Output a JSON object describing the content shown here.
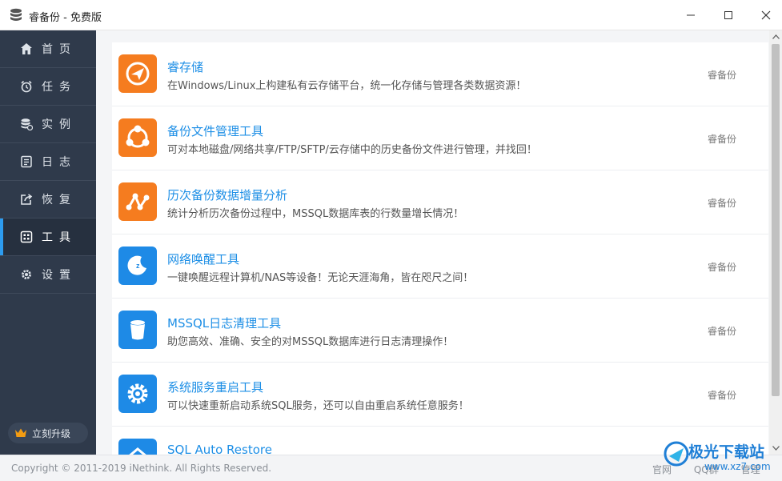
{
  "window": {
    "title": "睿备份 - 免费版"
  },
  "sidebar": {
    "items": [
      {
        "label": "首页",
        "icon": "home-icon"
      },
      {
        "label": "任务",
        "icon": "alarm-clock-icon"
      },
      {
        "label": "实例",
        "icon": "database-icon"
      },
      {
        "label": "日志",
        "icon": "log-document-icon"
      },
      {
        "label": "恢复",
        "icon": "restore-export-icon"
      },
      {
        "label": "工具",
        "icon": "tools-grid-icon",
        "active": true
      },
      {
        "label": "设置",
        "icon": "gear-icon"
      }
    ],
    "upgrade_label": "立刻升级"
  },
  "tools": [
    {
      "title": "睿存储",
      "desc": "在Windows/Linux上构建私有云存储平台，统一化存储与管理各类数据资源！",
      "vendor": "睿备份",
      "icon": "paper-plane-icon",
      "color": "#f57c1f"
    },
    {
      "title": "备份文件管理工具",
      "desc": "可对本地磁盘/网络共享/FTP/SFTP/云存储中的历史备份文件进行管理，并找回！",
      "vendor": "睿备份",
      "icon": "share-nodes-icon",
      "color": "#f57c1f"
    },
    {
      "title": "历次备份数据增量分析",
      "desc": "统计分析历次备份过程中，MSSQL数据库表的行数量增长情况！",
      "vendor": "睿备份",
      "icon": "graph-nodes-icon",
      "color": "#f57c1f"
    },
    {
      "title": "网络唤醒工具",
      "desc": "一键唤醒远程计算机/NAS等设备！无论天涯海角，皆在咫尺之间！",
      "vendor": "睿备份",
      "icon": "moon-sleep-icon",
      "color": "#1e8ae6"
    },
    {
      "title": "MSSQL日志清理工具",
      "desc": "助您高效、准确、安全的对MSSQL数据库进行日志清理操作！",
      "vendor": "睿备份",
      "icon": "trash-bin-icon",
      "color": "#1e8ae6"
    },
    {
      "title": "系统服务重启工具",
      "desc": "可以快速重新启动系统SQL服务，还可以自由重启系统任意服务！",
      "vendor": "睿备份",
      "icon": "gear-icon",
      "color": "#1e8ae6"
    },
    {
      "title": "SQL Auto Restore",
      "desc": "",
      "vendor": "",
      "icon": "restore-box-icon",
      "color": "#1e8ae6"
    }
  ],
  "footer": {
    "copyright": "Copyright © 2011-2019 iNethink. All Rights Reserved.",
    "links": [
      "官网",
      "QQ群",
      "管理"
    ]
  },
  "watermark": {
    "text": "极光下载站",
    "url": "www.xz7.com"
  }
}
